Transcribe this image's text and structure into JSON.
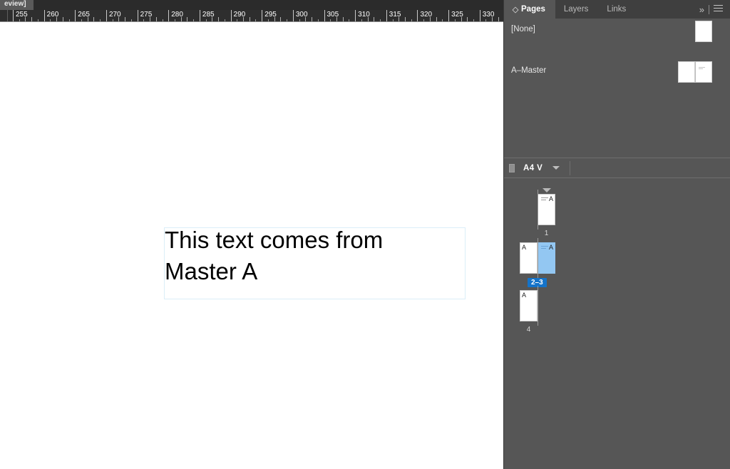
{
  "document": {
    "tab_label": "eview]"
  },
  "ruler": {
    "unit_start": 255,
    "unit_end": 330,
    "step": 5,
    "labels": [
      "255",
      "260",
      "265",
      "270",
      "275",
      "280",
      "285",
      "290",
      "295",
      "300",
      "305",
      "310",
      "315",
      "320",
      "325",
      "330"
    ]
  },
  "canvas": {
    "text_frame": {
      "content": "This text comes from\nMaster A"
    }
  },
  "panel": {
    "tabs": [
      {
        "label": "Pages",
        "active": true
      },
      {
        "label": "Layers",
        "active": false
      },
      {
        "label": "Links",
        "active": false
      }
    ],
    "tools": {
      "collapse_label": "»",
      "menu_label": "menu"
    },
    "masters": [
      {
        "name": "[None]",
        "type": "single"
      },
      {
        "name": "A–Master",
        "type": "spread"
      }
    ],
    "page_size": {
      "label": "A4 V",
      "caret": "▾"
    },
    "pages": [
      {
        "number_label": "1",
        "selected": false,
        "section_marker": true,
        "pages": [
          {
            "master": "A",
            "master_side": "rt",
            "selected": false,
            "has_text": true
          }
        ]
      },
      {
        "number_label": "2–3",
        "selected": true,
        "section_marker": false,
        "pages": [
          {
            "master": "A",
            "master_side": "lt",
            "selected": false,
            "has_text": false
          },
          {
            "master": "A",
            "master_side": "rt",
            "selected": true,
            "has_text": true
          }
        ]
      },
      {
        "number_label": "4",
        "selected": false,
        "section_marker": false,
        "pages": [
          {
            "master": "A",
            "master_side": "lt",
            "selected": false,
            "has_text": false
          }
        ]
      }
    ]
  },
  "colors": {
    "panel_bg": "#565656",
    "panel_tab_bg": "#3f3f3f",
    "ruler_bg": "#2e2e2e",
    "selection_blue": "#93c7f2",
    "label_blue": "#1473c9",
    "frame_border": "#dbeef8"
  }
}
